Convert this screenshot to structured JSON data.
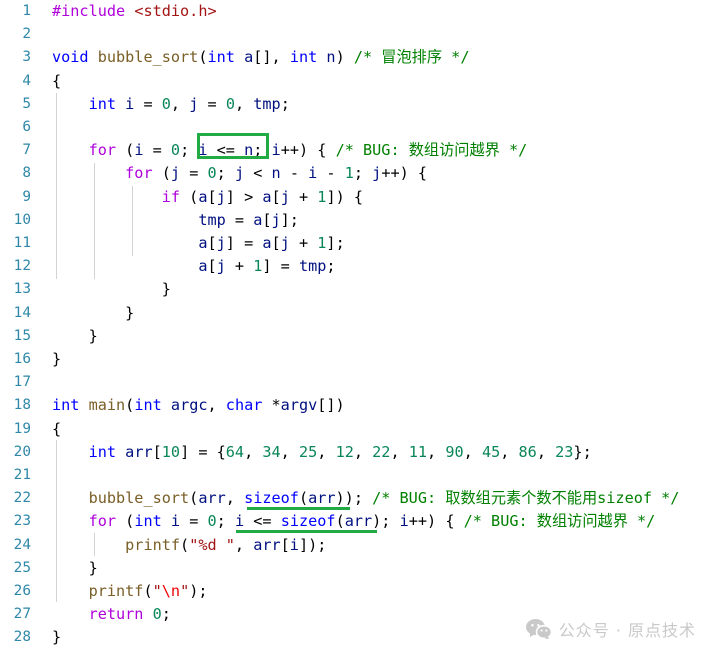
{
  "editor": {
    "language": "c",
    "background_color": "#ffffff",
    "line_number_color": "#2f88a8",
    "annotation_color": "#22aa44",
    "total_lines": 28
  },
  "line_numbers": [
    "1",
    "2",
    "3",
    "4",
    "5",
    "6",
    "7",
    "8",
    "9",
    "10",
    "11",
    "12",
    "13",
    "14",
    "15",
    "16",
    "17",
    "18",
    "19",
    "20",
    "21",
    "22",
    "23",
    "24",
    "25",
    "26",
    "27",
    "28"
  ],
  "code_lines": [
    {
      "n": "1",
      "text": "#include <stdio.h>"
    },
    {
      "n": "2",
      "text": ""
    },
    {
      "n": "3",
      "text": "void bubble_sort(int a[], int n) /* 冒泡排序 */"
    },
    {
      "n": "4",
      "text": "{"
    },
    {
      "n": "5",
      "text": "    int i = 0, j = 0, tmp;"
    },
    {
      "n": "6",
      "text": ""
    },
    {
      "n": "7",
      "text": "    for (i = 0; i <= n; i++) { /* BUG: 数组访问越界 */"
    },
    {
      "n": "8",
      "text": "        for (j = 0; j < n - i - 1; j++) {"
    },
    {
      "n": "9",
      "text": "            if (a[j] > a[j + 1]) {"
    },
    {
      "n": "10",
      "text": "                tmp = a[j];"
    },
    {
      "n": "11",
      "text": "                a[j] = a[j + 1];"
    },
    {
      "n": "12",
      "text": "                a[j + 1] = tmp;"
    },
    {
      "n": "13",
      "text": "            }"
    },
    {
      "n": "14",
      "text": "        }"
    },
    {
      "n": "15",
      "text": "    }"
    },
    {
      "n": "16",
      "text": "}"
    },
    {
      "n": "17",
      "text": ""
    },
    {
      "n": "18",
      "text": "int main(int argc, char *argv[])"
    },
    {
      "n": "19",
      "text": "{"
    },
    {
      "n": "20",
      "text": "    int arr[10] = {64, 34, 25, 12, 22, 11, 90, 45, 86, 23};"
    },
    {
      "n": "21",
      "text": ""
    },
    {
      "n": "22",
      "text": "    bubble_sort(arr, sizeof(arr)); /* BUG: 取数组元素个数不能用sizeof */"
    },
    {
      "n": "23",
      "text": "    for (int i = 0; i <= sizeof(arr); i++) { /* BUG: 数组访问越界 */"
    },
    {
      "n": "24",
      "text": "        printf(\"%d \", arr[i]);"
    },
    {
      "n": "25",
      "text": "    }"
    },
    {
      "n": "26",
      "text": "    printf(\"\\n\");"
    },
    {
      "n": "27",
      "text": "    return 0;"
    },
    {
      "n": "28",
      "text": "}"
    }
  ],
  "comments": {
    "line3": "/* 冒泡排序 */",
    "line7": "/* BUG: 数组访问越界 */",
    "line22": "/* BUG: 取数组元素个数不能用sizeof */",
    "line23": "/* BUG: 数组访问越界 */"
  },
  "array_literal": {
    "name": "arr",
    "size": "10",
    "values": [
      "64",
      "34",
      "25",
      "12",
      "22",
      "11",
      "90",
      "45",
      "86",
      "23"
    ]
  },
  "annotations": [
    {
      "kind": "box",
      "target_line": "7",
      "target_text": "i <= n;"
    },
    {
      "kind": "underline",
      "target_line": "22",
      "target_text": "sizeof(arr)"
    },
    {
      "kind": "underline",
      "target_line": "23",
      "target_text": "i <= sizeof(arr)"
    }
  ],
  "watermark": {
    "icon": "wechat-icon",
    "text": "公众号 · 原点技术",
    "color": "#c9c9c9"
  },
  "tokens": {
    "l1": [
      [
        "#include",
        "pre"
      ],
      [
        " ",
        "op"
      ],
      [
        "<stdio.h>",
        "hdr"
      ]
    ],
    "l3": [
      [
        "void",
        "kw"
      ],
      [
        " ",
        "op"
      ],
      [
        "bubble_sort",
        "fn"
      ],
      [
        "(",
        "op"
      ],
      [
        "int",
        "kw"
      ],
      [
        " ",
        "op"
      ],
      [
        "a",
        "var"
      ],
      [
        "[], ",
        "op"
      ],
      [
        "int",
        "kw"
      ],
      [
        " ",
        "op"
      ],
      [
        "n",
        "var"
      ],
      [
        ") ",
        "op"
      ],
      [
        "/* 冒泡排序 */",
        "cmt"
      ]
    ],
    "l4": [
      [
        "{",
        "op"
      ]
    ],
    "l5": [
      [
        "    ",
        "op"
      ],
      [
        "int",
        "kw"
      ],
      [
        " ",
        "op"
      ],
      [
        "i",
        "var"
      ],
      [
        " = ",
        "op"
      ],
      [
        "0",
        "num"
      ],
      [
        ", ",
        "op"
      ],
      [
        "j",
        "var"
      ],
      [
        " = ",
        "op"
      ],
      [
        "0",
        "num"
      ],
      [
        ", ",
        "op"
      ],
      [
        "tmp",
        "var"
      ],
      [
        ";",
        "op"
      ]
    ],
    "l7": [
      [
        "    ",
        "op"
      ],
      [
        "for",
        "ctl"
      ],
      [
        " (",
        "op"
      ],
      [
        "i",
        "var"
      ],
      [
        " = ",
        "op"
      ],
      [
        "0",
        "num"
      ],
      [
        "; ",
        "op"
      ],
      [
        "i",
        "var"
      ],
      [
        " <= ",
        "op"
      ],
      [
        "n",
        "var"
      ],
      [
        "; ",
        "op"
      ],
      [
        "i",
        "var"
      ],
      [
        "++) { ",
        "op"
      ],
      [
        "/* BUG: 数组访问越界 */",
        "cmt"
      ]
    ],
    "l8": [
      [
        "        ",
        "op"
      ],
      [
        "for",
        "ctl"
      ],
      [
        " (",
        "op"
      ],
      [
        "j",
        "var"
      ],
      [
        " = ",
        "op"
      ],
      [
        "0",
        "num"
      ],
      [
        "; ",
        "op"
      ],
      [
        "j",
        "var"
      ],
      [
        " < ",
        "op"
      ],
      [
        "n",
        "var"
      ],
      [
        " - ",
        "op"
      ],
      [
        "i",
        "var"
      ],
      [
        " - ",
        "op"
      ],
      [
        "1",
        "num"
      ],
      [
        "; ",
        "op"
      ],
      [
        "j",
        "var"
      ],
      [
        "++) {",
        "op"
      ]
    ],
    "l9": [
      [
        "            ",
        "op"
      ],
      [
        "if",
        "ctl"
      ],
      [
        " (",
        "op"
      ],
      [
        "a",
        "var"
      ],
      [
        "[",
        "op"
      ],
      [
        "j",
        "var"
      ],
      [
        "] > ",
        "op"
      ],
      [
        "a",
        "var"
      ],
      [
        "[",
        "op"
      ],
      [
        "j",
        "var"
      ],
      [
        " + ",
        "op"
      ],
      [
        "1",
        "num"
      ],
      [
        "]) {",
        "op"
      ]
    ],
    "l10": [
      [
        "                ",
        "op"
      ],
      [
        "tmp",
        "var"
      ],
      [
        " = ",
        "op"
      ],
      [
        "a",
        "var"
      ],
      [
        "[",
        "op"
      ],
      [
        "j",
        "var"
      ],
      [
        "];",
        "op"
      ]
    ],
    "l11": [
      [
        "                ",
        "op"
      ],
      [
        "a",
        "var"
      ],
      [
        "[",
        "op"
      ],
      [
        "j",
        "var"
      ],
      [
        "] = ",
        "op"
      ],
      [
        "a",
        "var"
      ],
      [
        "[",
        "op"
      ],
      [
        "j",
        "var"
      ],
      [
        " + ",
        "op"
      ],
      [
        "1",
        "num"
      ],
      [
        "];",
        "op"
      ]
    ],
    "l12": [
      [
        "                ",
        "op"
      ],
      [
        "a",
        "var"
      ],
      [
        "[",
        "op"
      ],
      [
        "j",
        "var"
      ],
      [
        " + ",
        "op"
      ],
      [
        "1",
        "num"
      ],
      [
        "] = ",
        "op"
      ],
      [
        "tmp",
        "var"
      ],
      [
        ";",
        "op"
      ]
    ],
    "l13": [
      [
        "            }",
        "op"
      ]
    ],
    "l14": [
      [
        "        }",
        "op"
      ]
    ],
    "l15": [
      [
        "    }",
        "op"
      ]
    ],
    "l16": [
      [
        "}",
        "op"
      ]
    ],
    "l18": [
      [
        "int",
        "kw"
      ],
      [
        " ",
        "op"
      ],
      [
        "main",
        "fn"
      ],
      [
        "(",
        "op"
      ],
      [
        "int",
        "kw"
      ],
      [
        " ",
        "op"
      ],
      [
        "argc",
        "var"
      ],
      [
        ", ",
        "op"
      ],
      [
        "char",
        "kw"
      ],
      [
        " *",
        "op"
      ],
      [
        "argv",
        "var"
      ],
      [
        "[])",
        "op"
      ]
    ],
    "l19": [
      [
        "{",
        "op"
      ]
    ],
    "l20": [
      [
        "    ",
        "op"
      ],
      [
        "int",
        "kw"
      ],
      [
        " ",
        "op"
      ],
      [
        "arr",
        "var"
      ],
      [
        "[",
        "op"
      ],
      [
        "10",
        "num"
      ],
      [
        "] = {",
        "op"
      ],
      [
        "64",
        "num"
      ],
      [
        ", ",
        "op"
      ],
      [
        "34",
        "num"
      ],
      [
        ", ",
        "op"
      ],
      [
        "25",
        "num"
      ],
      [
        ", ",
        "op"
      ],
      [
        "12",
        "num"
      ],
      [
        ", ",
        "op"
      ],
      [
        "22",
        "num"
      ],
      [
        ", ",
        "op"
      ],
      [
        "11",
        "num"
      ],
      [
        ", ",
        "op"
      ],
      [
        "90",
        "num"
      ],
      [
        ", ",
        "op"
      ],
      [
        "45",
        "num"
      ],
      [
        ", ",
        "op"
      ],
      [
        "86",
        "num"
      ],
      [
        ", ",
        "op"
      ],
      [
        "23",
        "num"
      ],
      [
        "};",
        "op"
      ]
    ],
    "l22": [
      [
        "    ",
        "op"
      ],
      [
        "bubble_sort",
        "fn"
      ],
      [
        "(",
        "op"
      ],
      [
        "arr",
        "var"
      ],
      [
        ", ",
        "op"
      ],
      [
        "sizeof",
        "kw"
      ],
      [
        "(",
        "op"
      ],
      [
        "arr",
        "var"
      ],
      [
        ")); ",
        "op"
      ],
      [
        "/* BUG: 取数组元素个数不能用sizeof */",
        "cmt"
      ]
    ],
    "l23": [
      [
        "    ",
        "op"
      ],
      [
        "for",
        "ctl"
      ],
      [
        " (",
        "op"
      ],
      [
        "int",
        "kw"
      ],
      [
        " ",
        "op"
      ],
      [
        "i",
        "var"
      ],
      [
        " = ",
        "op"
      ],
      [
        "0",
        "num"
      ],
      [
        "; ",
        "op"
      ],
      [
        "i",
        "var"
      ],
      [
        " <= ",
        "op"
      ],
      [
        "sizeof",
        "kw"
      ],
      [
        "(",
        "op"
      ],
      [
        "arr",
        "var"
      ],
      [
        "); ",
        "op"
      ],
      [
        "i",
        "var"
      ],
      [
        "++) { ",
        "op"
      ],
      [
        "/* BUG: 数组访问越界 */",
        "cmt"
      ]
    ],
    "l24": [
      [
        "        ",
        "op"
      ],
      [
        "printf",
        "fn"
      ],
      [
        "(",
        "op"
      ],
      [
        "\"%d \"",
        "str"
      ],
      [
        ", ",
        "op"
      ],
      [
        "arr",
        "var"
      ],
      [
        "[",
        "op"
      ],
      [
        "i",
        "var"
      ],
      [
        "]);",
        "op"
      ]
    ],
    "l25": [
      [
        "    }",
        "op"
      ]
    ],
    "l26": [
      [
        "    ",
        "op"
      ],
      [
        "printf",
        "fn"
      ],
      [
        "(",
        "op"
      ],
      [
        "\"",
        "str"
      ],
      [
        "\\n",
        "esc"
      ],
      [
        "\"",
        "str"
      ],
      [
        ");",
        "op"
      ]
    ],
    "l27": [
      [
        "    ",
        "op"
      ],
      [
        "return",
        "ctl"
      ],
      [
        " ",
        "op"
      ],
      [
        "0",
        "num"
      ],
      [
        ";",
        "op"
      ]
    ],
    "l28": [
      [
        "}",
        "op"
      ]
    ]
  }
}
